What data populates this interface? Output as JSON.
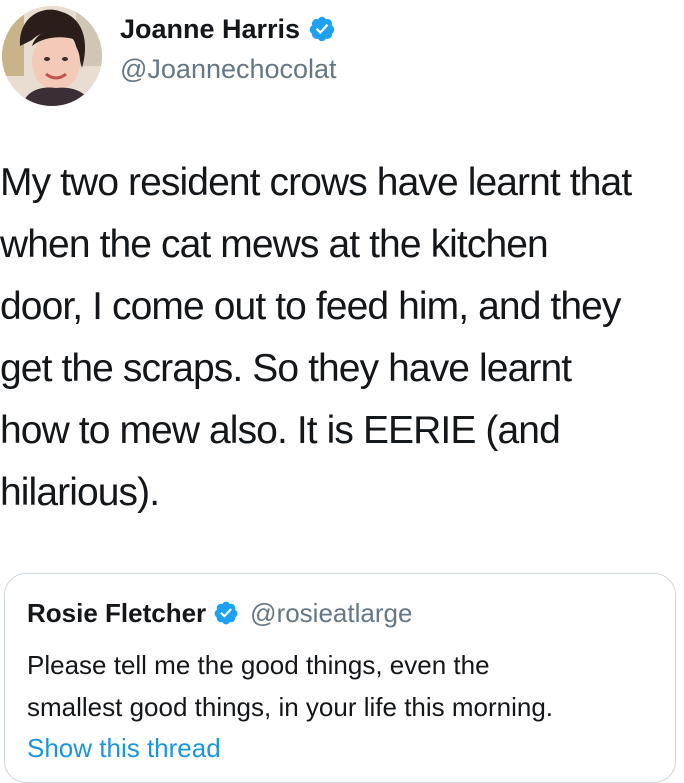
{
  "tweet": {
    "author": {
      "name": "Joanne Harris",
      "handle": "@Joannechocolat",
      "verified": true,
      "avatar": "avatar-icon"
    },
    "text": "My two resident crows have learnt that\nwhen the cat mews at the kitchen\ndoor, I come out to feed him, and they\nget the scraps. So they have learnt\nhow to mew also. It is EERIE (and\nhilarious)."
  },
  "quoted_tweet": {
    "author": {
      "name": "Rosie Fletcher",
      "handle": "@rosieatlarge",
      "verified": true
    },
    "text": "Please tell me the good things, even the\nsmallest good things, in your life this morning.",
    "show_thread_label": "Show this thread"
  },
  "colors": {
    "text": "#14171a",
    "secondary": "#657786",
    "link": "#1b95e0",
    "verified": "#1da1f2",
    "border": "#ccd6dd"
  }
}
